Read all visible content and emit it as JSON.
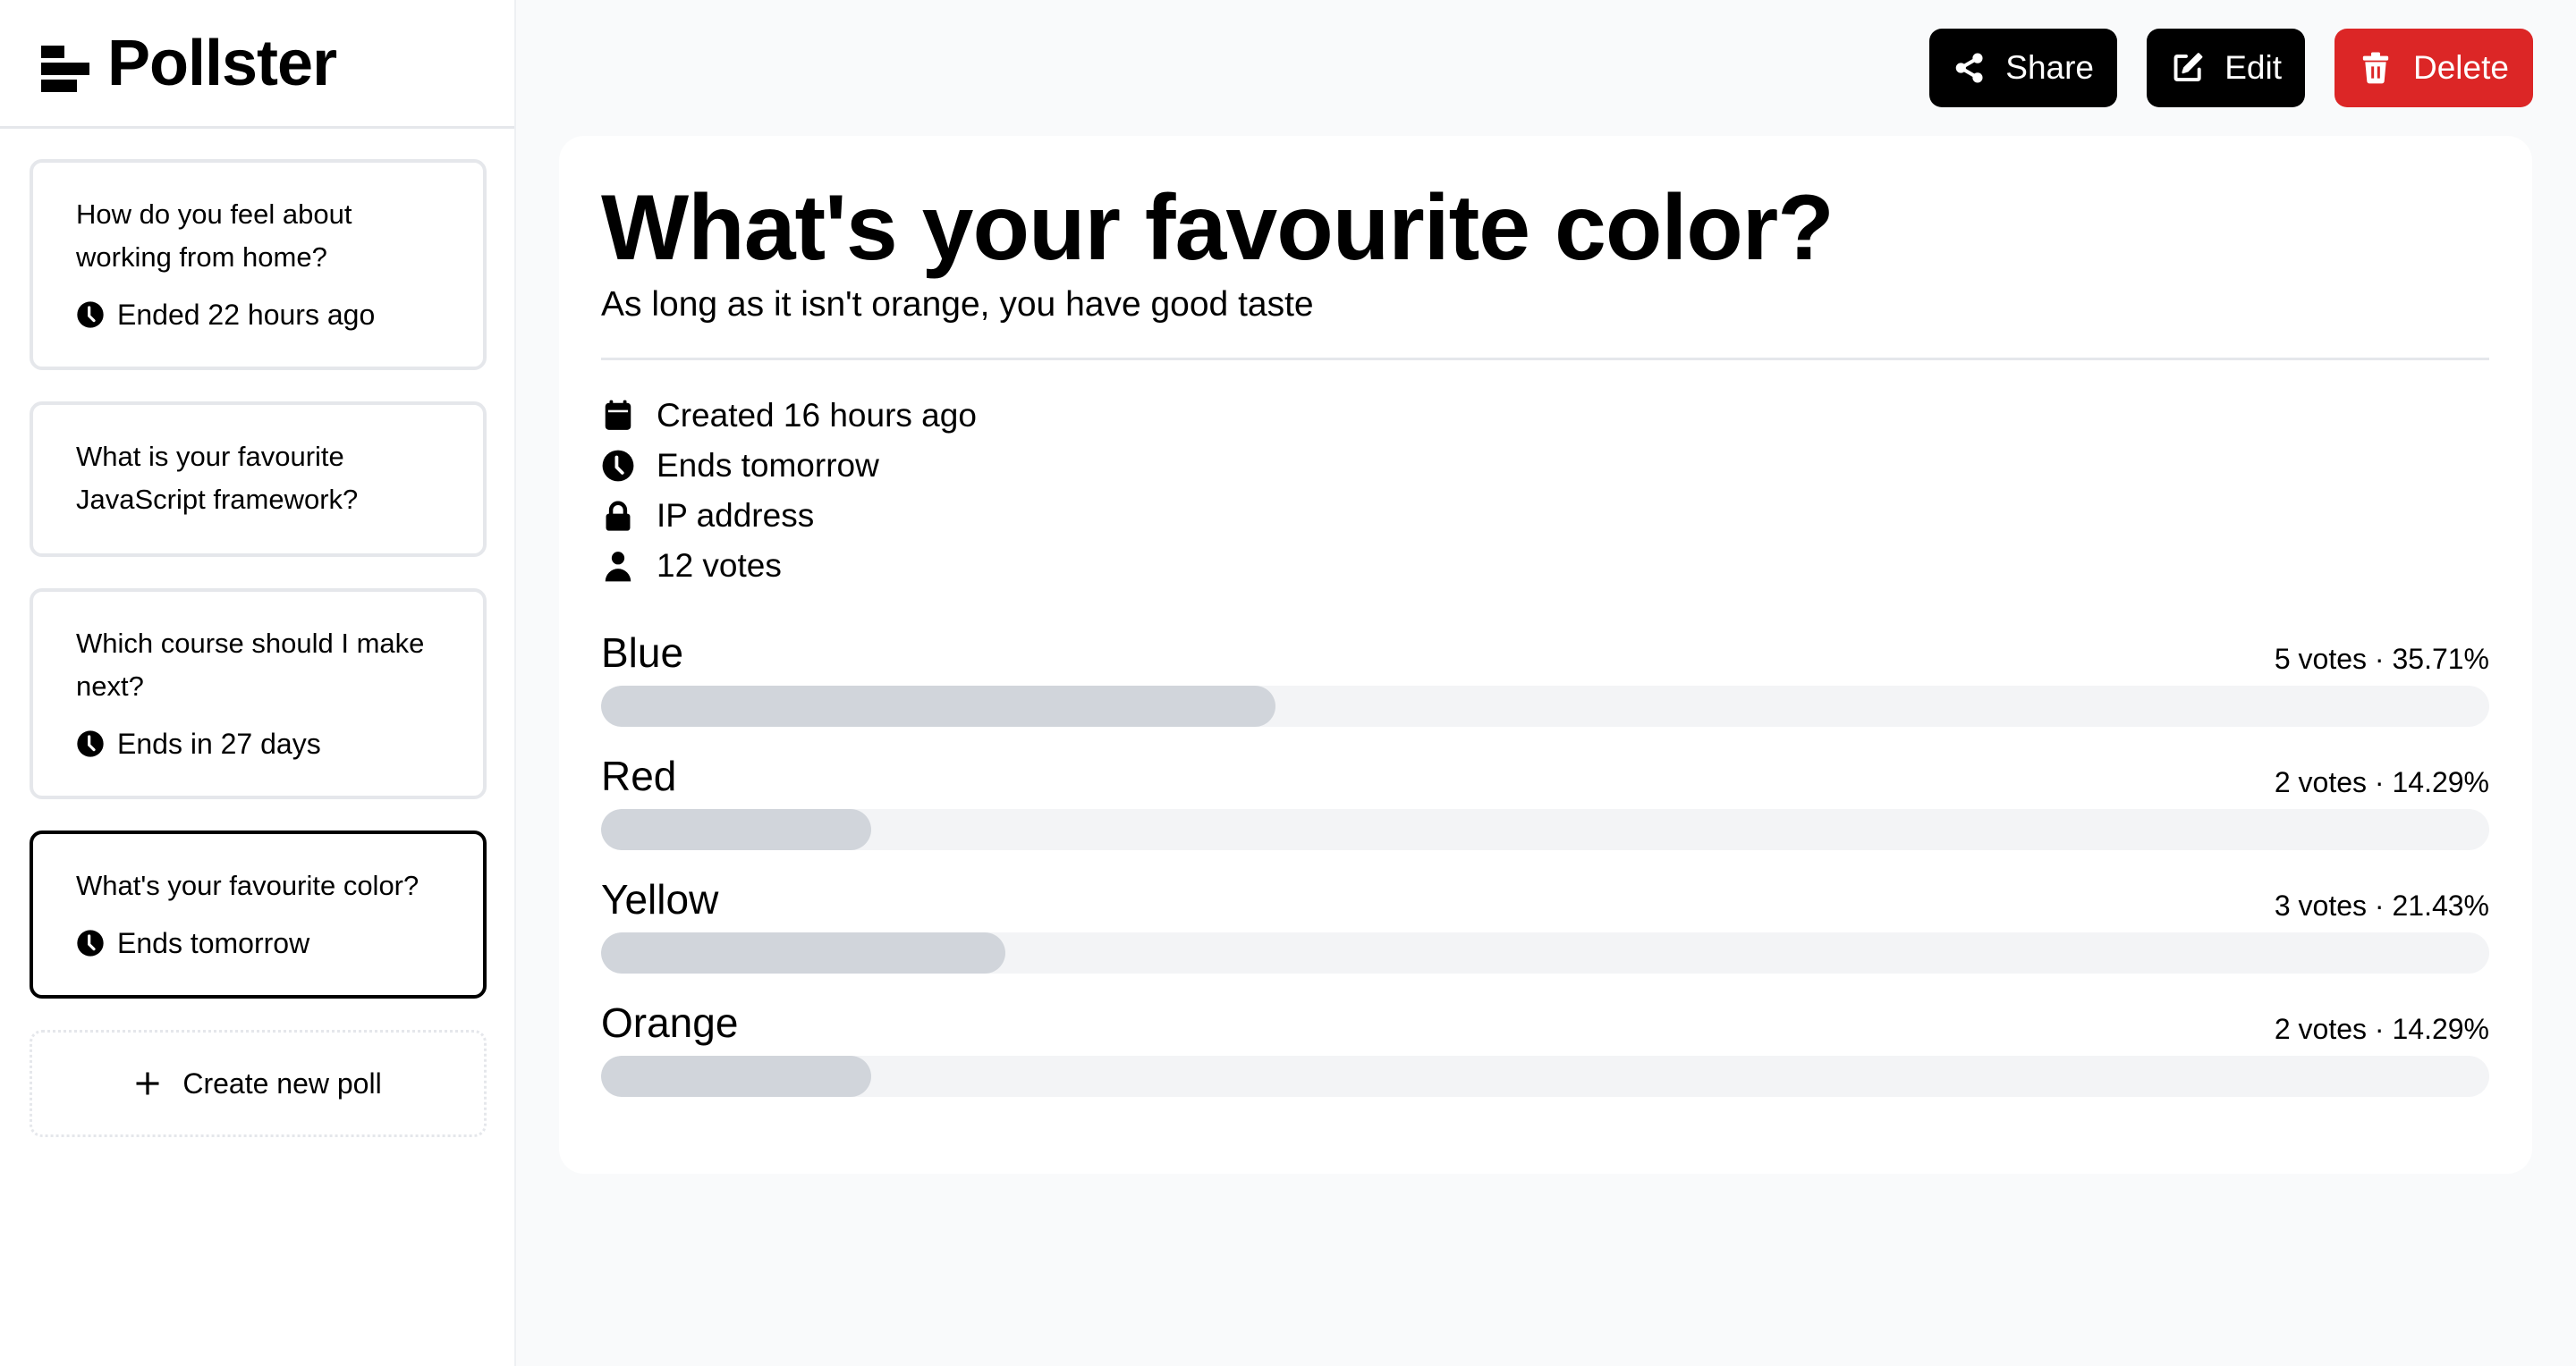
{
  "app": {
    "name": "Pollster"
  },
  "sidebar": {
    "polls": [
      {
        "question": "How do you feel about working from home?",
        "status": "Ended 22 hours ago",
        "active": false
      },
      {
        "question": "What is your favourite JavaScript framework?",
        "status": null,
        "active": false
      },
      {
        "question": "Which course should I make next?",
        "status": "Ends in 27 days",
        "active": false
      },
      {
        "question": "What's your favourite color?",
        "status": "Ends tomorrow",
        "active": true
      }
    ],
    "create_label": "Create new poll"
  },
  "toolbar": {
    "share_label": "Share",
    "edit_label": "Edit",
    "delete_label": "Delete",
    "delete_color": "#dc2626"
  },
  "poll": {
    "title": "What's your favourite color?",
    "subtitle": "As long as it isn't orange, you have good taste",
    "meta": {
      "created": "Created 16 hours ago",
      "ends": "Ends tomorrow",
      "restriction": "IP address",
      "votes": "12 votes"
    },
    "options": [
      {
        "label": "Blue",
        "count_text": "5 votes · 35.71%",
        "percent": 35.71
      },
      {
        "label": "Red",
        "count_text": "2 votes · 14.29%",
        "percent": 14.29
      },
      {
        "label": "Yellow",
        "count_text": "3 votes · 21.43%",
        "percent": 21.43
      },
      {
        "label": "Orange",
        "count_text": "2 votes · 14.29%",
        "percent": 14.29
      }
    ]
  }
}
